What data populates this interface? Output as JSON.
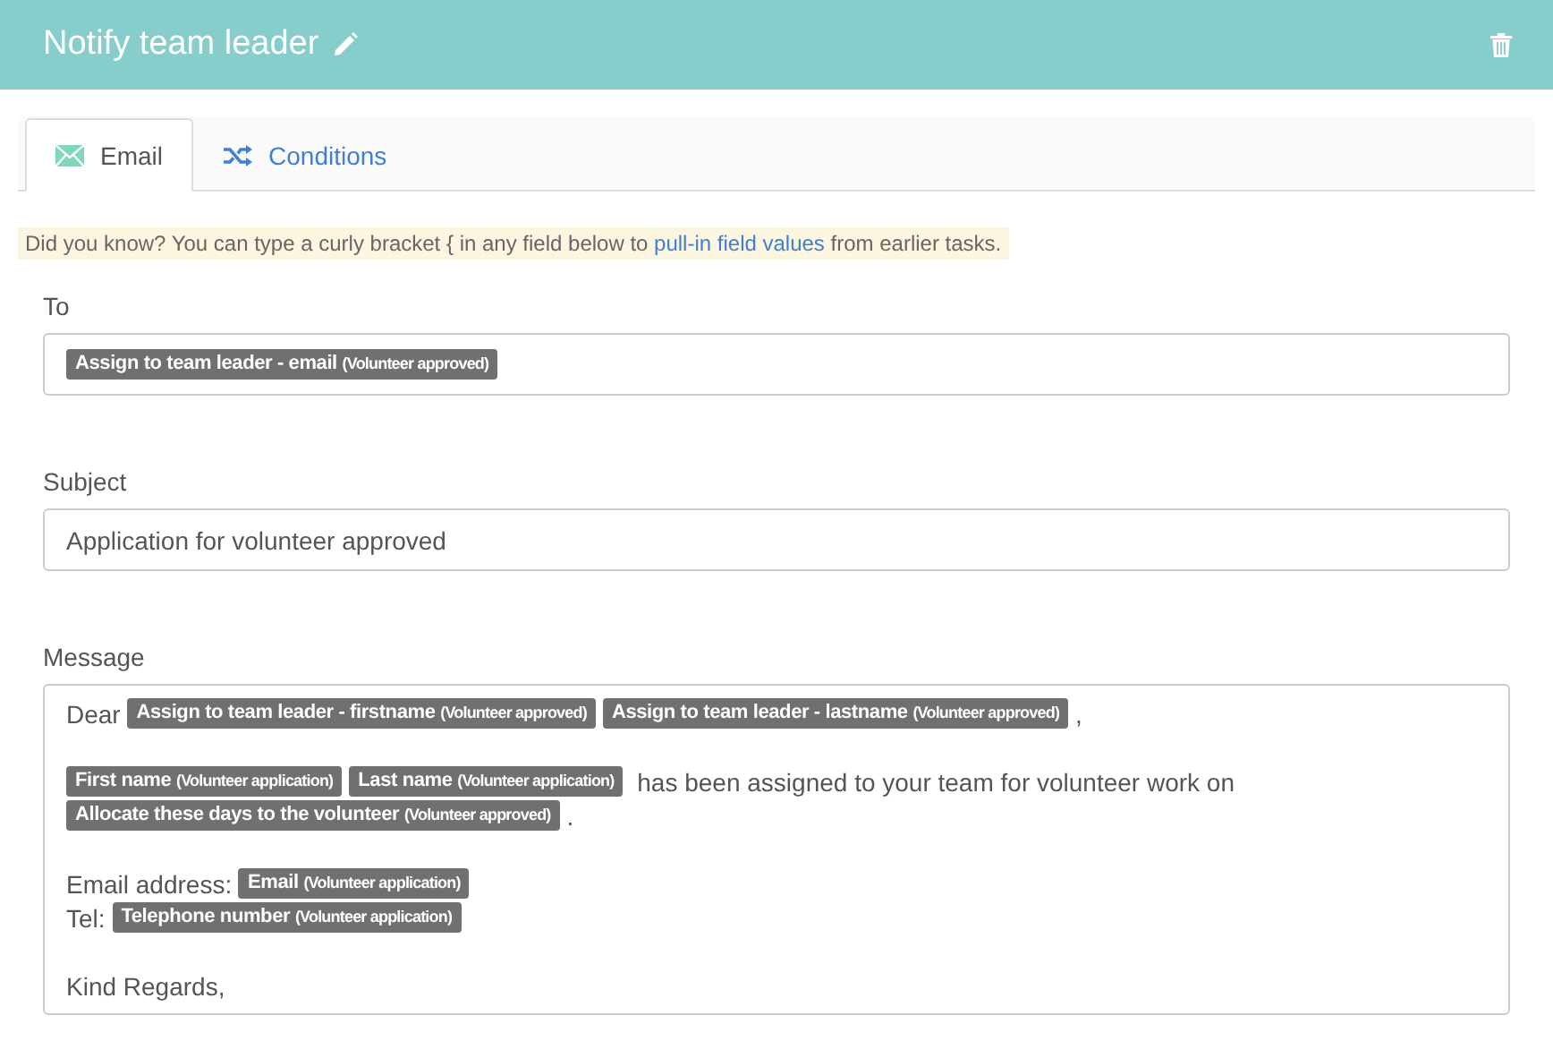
{
  "header": {
    "title": "Notify team leader"
  },
  "tabs": [
    {
      "label": "Email",
      "selected": true
    },
    {
      "label": "Conditions",
      "selected": false
    }
  ],
  "hint": {
    "before": "Did you know? You can type a curly bracket { in any field below to ",
    "link": "pull-in field values",
    "after": " from earlier tasks."
  },
  "to": {
    "label": "To",
    "tokens": [
      {
        "field": "Assign to team leader - email",
        "source": "(Volunteer approved)"
      }
    ]
  },
  "subject": {
    "label": "Subject",
    "value": "Application for volunteer approved"
  },
  "message": {
    "label": "Message",
    "paragraphs": [
      [
        [
          {
            "kind": "text",
            "text": "Dear "
          },
          {
            "kind": "token",
            "field": "Assign to team leader - firstname",
            "source": "(Volunteer approved)"
          },
          {
            "kind": "token",
            "field": "Assign to team leader - lastname",
            "source": "(Volunteer approved)"
          },
          {
            "kind": "text",
            "text": ","
          }
        ]
      ],
      [
        [
          {
            "kind": "token",
            "field": "First name",
            "source": "(Volunteer application)"
          },
          {
            "kind": "token",
            "field": "Last name",
            "source": "(Volunteer application)"
          },
          {
            "kind": "text",
            "text": " has been assigned to your team for volunteer work on"
          }
        ],
        [
          {
            "kind": "token",
            "field": "Allocate these days to the volunteer",
            "source": "(Volunteer approved)"
          },
          {
            "kind": "text",
            "text": "."
          }
        ]
      ],
      [
        [
          {
            "kind": "text",
            "text": "Email address: "
          },
          {
            "kind": "token",
            "field": "Email",
            "source": "(Volunteer application)"
          }
        ],
        [
          {
            "kind": "text",
            "text": "Tel: "
          },
          {
            "kind": "token",
            "field": "Telephone number",
            "source": "(Volunteer application)"
          }
        ]
      ],
      [
        [
          {
            "kind": "text",
            "text": "Kind Regards,"
          }
        ]
      ]
    ]
  }
}
